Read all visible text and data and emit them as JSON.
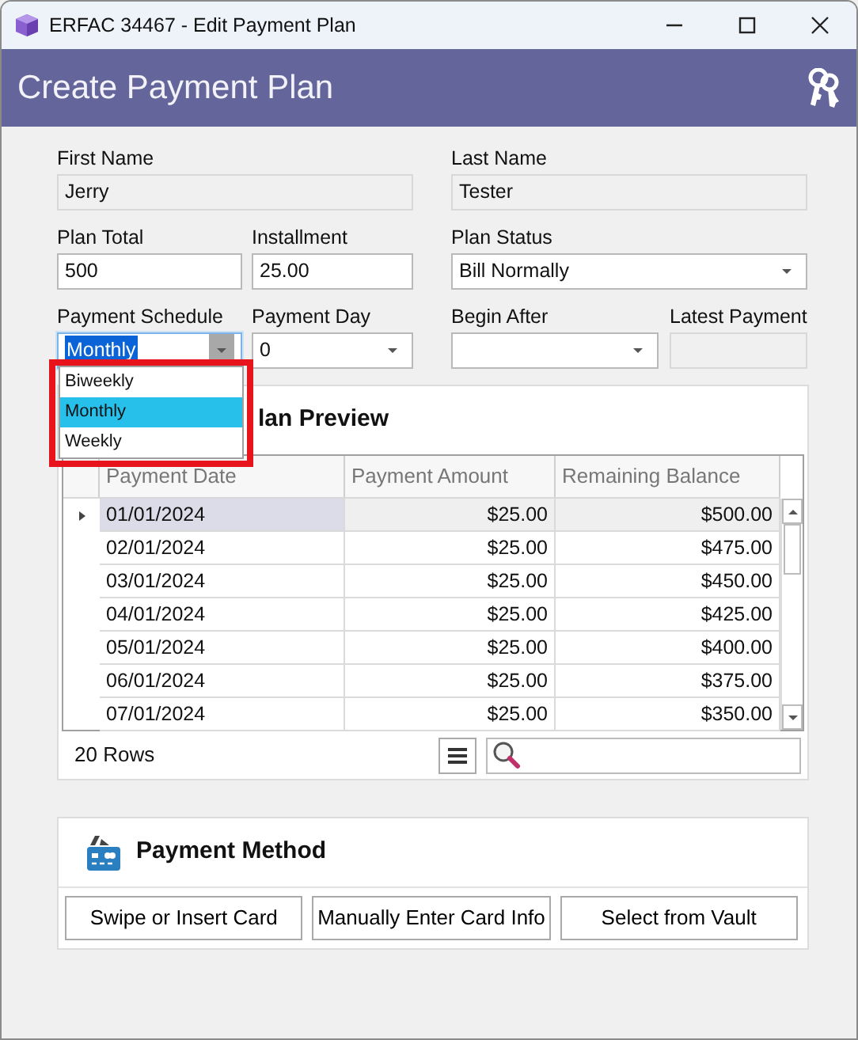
{
  "window": {
    "title": "ERFAC 34467 - Edit Payment Plan"
  },
  "header": {
    "title": "Create Payment Plan"
  },
  "form_rows": [
    [
      {
        "label": "First Name",
        "kind": "readonly",
        "value": "Jerry"
      },
      {
        "label": "Last Name",
        "kind": "readonly",
        "value": "Tester"
      }
    ],
    [
      {
        "label": "Plan Total",
        "kind": "text",
        "value": "500"
      },
      {
        "label": "Installment",
        "kind": "text",
        "value": "25.00"
      },
      {
        "label": "Plan Status",
        "kind": "combo",
        "value": "Bill Normally",
        "expanded": false
      }
    ],
    [
      {
        "label": "Payment Schedule",
        "kind": "combo",
        "value": "Monthly",
        "expanded": true,
        "options": [
          {
            "label": "Biweekly",
            "selected": false
          },
          {
            "label": "Monthly",
            "selected": true
          },
          {
            "label": "Weekly",
            "selected": false
          }
        ]
      },
      {
        "label": "Payment Day",
        "kind": "combo",
        "value": "0",
        "expanded": false
      },
      {
        "label": "Begin After",
        "kind": "combo",
        "expanded": false
      },
      {
        "label": "Latest Payment",
        "kind": "readonly"
      }
    ]
  ],
  "plan_preview": {
    "title": "lan Preview",
    "columns": [
      "Payment Date",
      "Payment Amount",
      "Remaining Balance"
    ],
    "rows": [
      {
        "cells": [
          "01/01/2024",
          "$25.00",
          "$500.00"
        ],
        "selected": true
      },
      {
        "cells": [
          "02/01/2024",
          "$25.00",
          "$475.00"
        ],
        "selected": false
      },
      {
        "cells": [
          "03/01/2024",
          "$25.00",
          "$450.00"
        ],
        "selected": false
      },
      {
        "cells": [
          "04/01/2024",
          "$25.00",
          "$425.00"
        ],
        "selected": false
      },
      {
        "cells": [
          "05/01/2024",
          "$25.00",
          "$400.00"
        ],
        "selected": false
      },
      {
        "cells": [
          "06/01/2024",
          "$25.00",
          "$375.00"
        ],
        "selected": false
      },
      {
        "cells": [
          "07/01/2024",
          "$25.00",
          "$350.00"
        ],
        "selected": false
      }
    ],
    "row_count": "20 Rows"
  },
  "payment_method": {
    "title": "Payment Method",
    "buttons": [
      "Swipe or Insert Card",
      "Manually Enter Card Info",
      "Select from Vault"
    ]
  }
}
